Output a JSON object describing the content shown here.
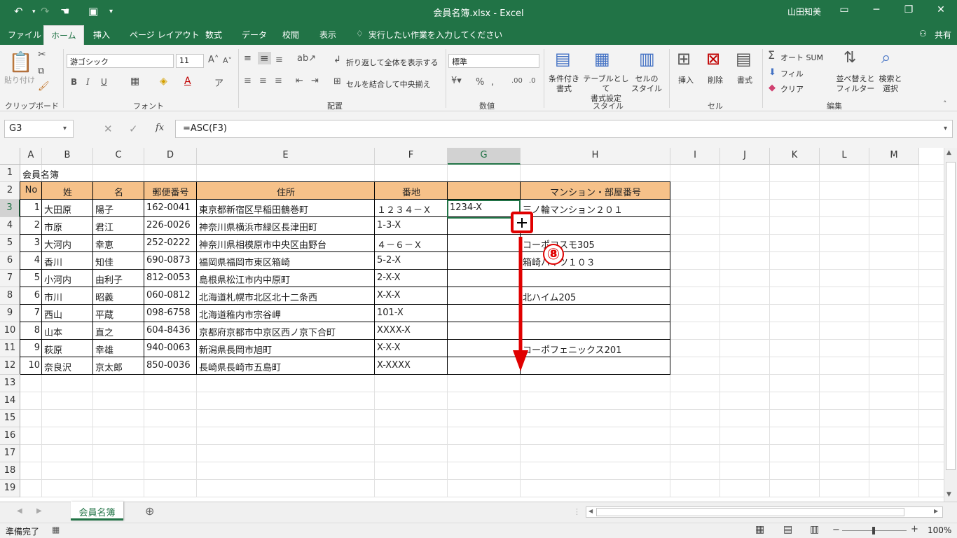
{
  "window": {
    "title": "会員名簿.xlsx  -  Excel",
    "user": "山田知美",
    "share": "共有"
  },
  "ribbon_tabs": [
    "ファイル",
    "ホーム",
    "挿入",
    "ページ レイアウト",
    "数式",
    "データ",
    "校閲",
    "表示"
  ],
  "tell_me": "実行したい作業を入力してください",
  "ribbon": {
    "paste": "貼り付け",
    "clipboard": "クリップボード",
    "font_name": "游ゴシック",
    "font_size": "11",
    "font_group": "フォント",
    "wrap": "折り返して全体を表示する",
    "merge": "セルを結合して中央揃え",
    "align_group": "配置",
    "number_format": "標準",
    "number_group": "数値",
    "cond_format": "条件付き\n書式",
    "table_format": "テーブルとして\n書式設定",
    "cell_style": "セルの\nスタイル",
    "style_group": "スタイル",
    "insert": "挿入",
    "delete": "削除",
    "format": "書式",
    "cells_group": "セル",
    "autosum": "オート SUM",
    "fill": "フィル",
    "clear": "クリア",
    "sort": "並べ替えと\nフィルター",
    "find": "検索と\n選択",
    "edit_group": "編集"
  },
  "formula_bar": {
    "name_box": "G3",
    "formula": "=ASC(F3)"
  },
  "columns": [
    "A",
    "B",
    "C",
    "D",
    "E",
    "F",
    "G",
    "H",
    "I",
    "J",
    "K",
    "L",
    "M"
  ],
  "rows": [
    "1",
    "2",
    "3",
    "4",
    "5",
    "6",
    "7",
    "8",
    "9",
    "10",
    "11",
    "12",
    "13",
    "14",
    "15",
    "16",
    "17",
    "18",
    "19"
  ],
  "title_cell": "会員名簿",
  "headers": [
    "No",
    "姓",
    "名",
    "郵便番号",
    "住所",
    "番地",
    "",
    "マンション・部屋番号"
  ],
  "data": [
    [
      "1",
      "大田原",
      "陽子",
      "162-0041",
      "東京都新宿区早稲田鶴巻町",
      "１２３４－Ｘ",
      "1234-X",
      "三ノ輪マンション２０１"
    ],
    [
      "2",
      "市原",
      "君江",
      "226-0026",
      "神奈川県横浜市緑区長津田町",
      "1-3-X",
      "",
      ""
    ],
    [
      "3",
      "大河内",
      "幸恵",
      "252-0222",
      "神奈川県相模原市中央区由野台",
      "４－６－Ｘ",
      "",
      "コーポコスモ305"
    ],
    [
      "4",
      "香川",
      "知佳",
      "690-0873",
      "福岡県福岡市東区箱崎",
      "5-2-X",
      "",
      "箱崎ハイツ１０３"
    ],
    [
      "5",
      "小河内",
      "由利子",
      "812-0053",
      "島根県松江市内中原町",
      "2-X-X",
      "",
      ""
    ],
    [
      "6",
      "市川",
      "昭義",
      "060-0812",
      "北海道札幌市北区北十二条西",
      "X-X-X",
      "",
      "北ハイム205"
    ],
    [
      "7",
      "西山",
      "平蔵",
      "098-6758",
      "北海道稚内市宗谷岬",
      "101-X",
      "",
      ""
    ],
    [
      "8",
      "山本",
      "直之",
      "604-8436",
      "京都府京都市中京区西ノ京下合町",
      "XXXX-X",
      "",
      ""
    ],
    [
      "9",
      "萩原",
      "幸雄",
      "940-0063",
      "新潟県長岡市旭町",
      "X-X-X",
      "",
      "コーポフェニックス201"
    ],
    [
      "10",
      "奈良沢",
      "京太郎",
      "850-0036",
      "長崎県長崎市五島町",
      "X-XXXX",
      "",
      ""
    ]
  ],
  "annotation": "⑧",
  "sheet_tab": "会員名簿",
  "status": {
    "ready": "準備完了",
    "zoom": "100%"
  }
}
